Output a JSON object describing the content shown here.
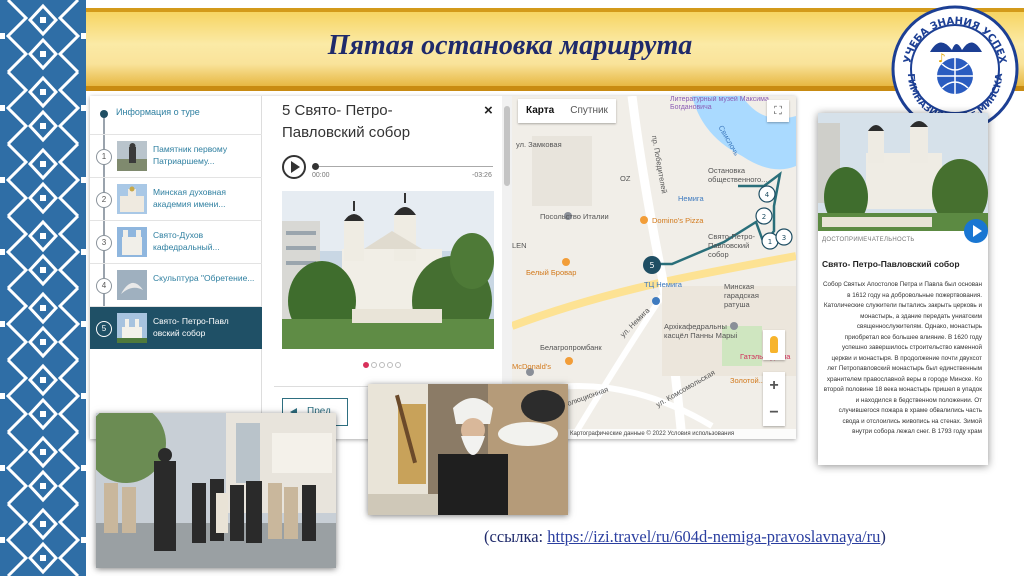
{
  "slide": {
    "title": "Пятая остановка маршрута",
    "link_prefix": "(ссылка: ",
    "link_text": "https://izi.travel/ru/604d-nemiga-pravoslavnaya/ru",
    "link_suffix": ")"
  },
  "logo": {
    "top_text": "УЧЕБА ЗНАНИЯ УСПЕХ",
    "bottom_text": "ГИМНАЗИЯ №15 г.МИНСКА"
  },
  "tour": {
    "info_label": "Информация о туре",
    "items": [
      {
        "num": "1",
        "label": "Памятник первому Патриаршему..."
      },
      {
        "num": "2",
        "label": "Минская духовная академия имени..."
      },
      {
        "num": "3",
        "label": "Свято-Духов кафедральный..."
      },
      {
        "num": "4",
        "label": "Скульптура \"Обретение..."
      },
      {
        "num": "5",
        "label": "Свято- Петро-Павл овский собор"
      }
    ]
  },
  "detail": {
    "title": "5 Свято- Петро-Павловский собор",
    "close": "×",
    "time_start": "00:00",
    "time_end": "-03:26",
    "prev_label": "Пред"
  },
  "map": {
    "tab_map": "Карта",
    "tab_satellite": "Спутник",
    "fullscreen_icon": "⛶",
    "zoom_in": "+",
    "zoom_out": "−",
    "footer": "Сочетания клавиш   Картографические данные © 2022   Условия использования",
    "labels": {
      "museum": "Литературный музей Максима Богдановича",
      "svisloch": "Свислочь",
      "zamkovaya": "ул. Замковая",
      "pobediteley": "пр. Победителей",
      "stop": "Остановка общественного...",
      "oz": "OZ",
      "nemiga_metro": "Немига",
      "italy": "Посольство Италии",
      "dominos": "Domino's Pizza",
      "church": "Свято-Петро-Павловский собор",
      "len": "LEN",
      "brovar": "Белый Бровар",
      "tc": "ТЦ Немига",
      "ratusha": "Минская гарадская ратуша",
      "arch": "Архікафедральны касцёл Панны Марыі",
      "nemiga_st": "ул. Немига",
      "bank": "Белагропромбанк",
      "mcd": "McDonald's",
      "komsom": "ул. Комсомольская",
      "revol": "ул. Революционная",
      "gatal": "Гатэль Еўропа",
      "zolotoy": "Золотой..."
    },
    "pins": [
      "5",
      "4",
      "2",
      "1",
      "3"
    ]
  },
  "mobile": {
    "category": "ДОСТОПРИМЕЧАТЕЛЬНОСТЬ",
    "title": "Свято- Петро-Павловский собор",
    "text": "Собор Святых Апостолов Петра и Павла был основан в 1612 году на добровольные пожертвования. Католические служители пытались закрыть церковь и монастырь, а здание передать униатским священнослужителям. Однако, монастырь приобретал все большее влияние. В 1620 году успешно завершилось строительство каменной церкви и монастыря. В продолжение почти двухсот лет Петропавловский монастырь был единственным хранителем православной веры в городе Минске. Ко второй половине 18 века монастырь пришел в упадок и находился в бедственном положении. От случившегося пожара в храме обвалились часть свода и отслоились живопись на стенах. Зимой внутри собора лежал снег. В 1793 году храм"
  }
}
